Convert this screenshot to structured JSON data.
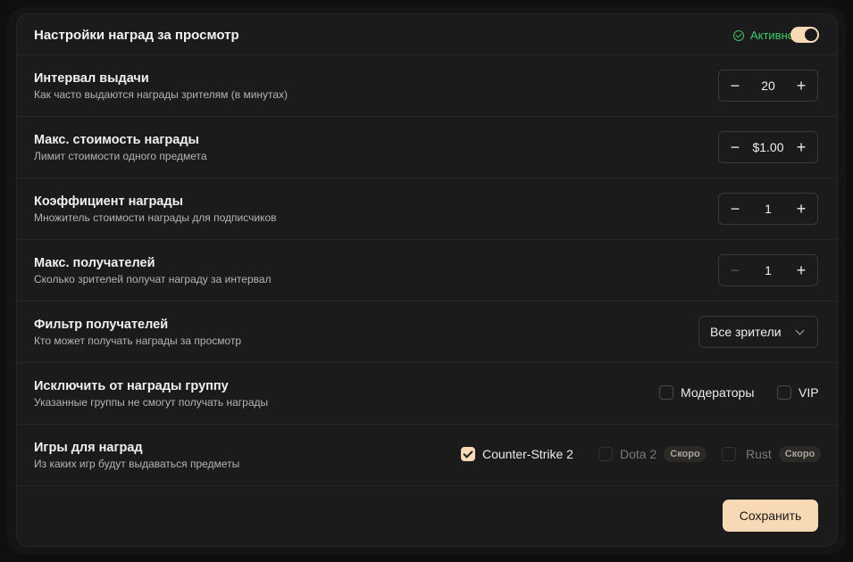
{
  "header": {
    "title": "Настройки наград за просмотр",
    "status_text": "Активно",
    "toggle_on": true
  },
  "rows": [
    {
      "title": "Интервал выдачи",
      "desc": "Как часто выдаются награды зрителям (в минутах)",
      "value": "20"
    },
    {
      "title": "Макс. стоимость награды",
      "desc": "Лимит стоимости одного предмета",
      "value": "$1.00"
    },
    {
      "title": "Коэффициент награды",
      "desc": "Множитель стоимости награды для подписчиков",
      "value": "1"
    },
    {
      "title": "Макс. получателей",
      "desc": "Сколько зрителей получат награду за интервал",
      "value": "1"
    },
    {
      "title": "Фильтр получателей",
      "desc": "Кто может получать награды за просмотр",
      "value": "Все зрители"
    },
    {
      "title": "Исключить от награды группу",
      "desc": "Указанные группы не смогут получать награды"
    },
    {
      "title": "Игры для наград",
      "desc": "Из каких игр будут выдаваться предметы"
    }
  ],
  "exclude_groups": [
    {
      "label": "Модераторы",
      "checked": false
    },
    {
      "label": "VIP",
      "checked": false
    }
  ],
  "games": [
    {
      "label": "Counter-Strike 2",
      "checked": true,
      "badge": ""
    },
    {
      "label": "Dota 2",
      "checked": false,
      "badge": "Скоро"
    },
    {
      "label": "Rust",
      "checked": false,
      "badge": "Скоро"
    }
  ],
  "stepper": {
    "minus": "−",
    "plus": "+"
  },
  "save_label": "Сохранить",
  "colors": {
    "accent": "#f7d9b5",
    "status_green": "#3cc86a",
    "card_bg": "#1b1b1b"
  }
}
